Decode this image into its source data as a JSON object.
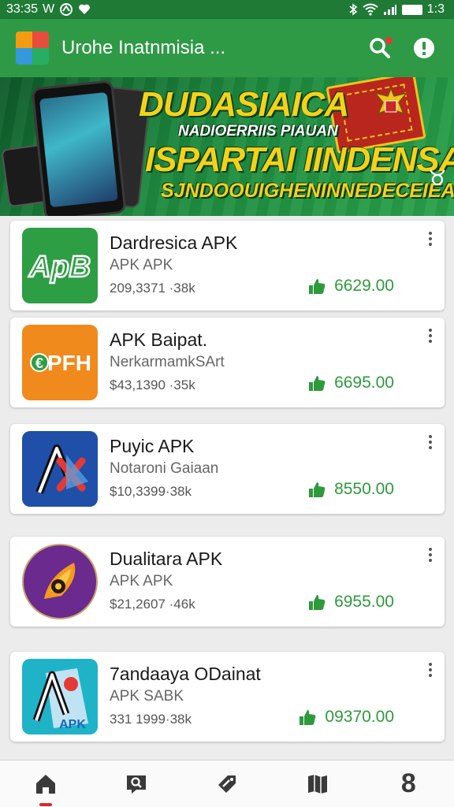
{
  "status_bar": {
    "time": "33:35",
    "left_letter": "W",
    "right_clock": "1:3"
  },
  "app_bar": {
    "title": "Urohe Inatnmisia ..."
  },
  "banner": {
    "line1": "DUDASIAICA",
    "line2": "NADIOERRIIS PIAUAN",
    "line3": "ISPARTAI IINDENSAN",
    "line4": "SJNDOOUIGHENINNEDECEIEAI"
  },
  "apps": [
    {
      "name": "Dardresica APK",
      "subtitle": "APK APK",
      "stats": "209,3371 ·38k",
      "price": "6629.00",
      "icon": "apb-logo-icon",
      "icon_text": "ApB",
      "icon_color": "#2e9e44"
    },
    {
      "name": "APK Baipat.",
      "subtitle": "NerkarmamkSArt",
      "stats": "$43,1390 ·35k",
      "price": "6695.00",
      "icon": "epfh-logo-icon",
      "icon_text": "EPFH",
      "icon_color": "#f08a1c"
    },
    {
      "name": "Puyic APK",
      "subtitle": "Notaroni Gaiaan",
      "stats": "$10,3399·38k",
      "price": "8550.00",
      "icon": "ax-logo-icon",
      "icon_text": "AX",
      "icon_color": "#1f4fa8"
    },
    {
      "name": "Dualitara APK",
      "subtitle": "APK APK",
      "stats": "$21,2607 ·46k",
      "price": "6955.00",
      "icon": "pen-nib-logo-icon",
      "icon_text": "",
      "icon_color": "#6a2a8e"
    },
    {
      "name": "7andaaya ODainat",
      "subtitle": "APK SABK",
      "stats": "331 1999·38k",
      "price": "09370.00",
      "icon": "apk-map-logo-icon",
      "icon_text": "APK",
      "icon_color": "#1fb3c8"
    }
  ],
  "bottom_nav": [
    {
      "name": "home",
      "icon": "home-icon",
      "active": true
    },
    {
      "name": "search",
      "icon": "search-book-icon",
      "active": false
    },
    {
      "name": "tools",
      "icon": "tag-icon",
      "active": false
    },
    {
      "name": "library",
      "icon": "map-book-icon",
      "active": false
    },
    {
      "name": "profile",
      "icon": "figure-8-icon",
      "active": false
    }
  ],
  "nav_glyph_profile": "8",
  "colors": {
    "primary": "#2f9a46",
    "status_bar": "#1f7a36",
    "price": "#2e9a3c",
    "accent_red": "#d62b2b"
  }
}
